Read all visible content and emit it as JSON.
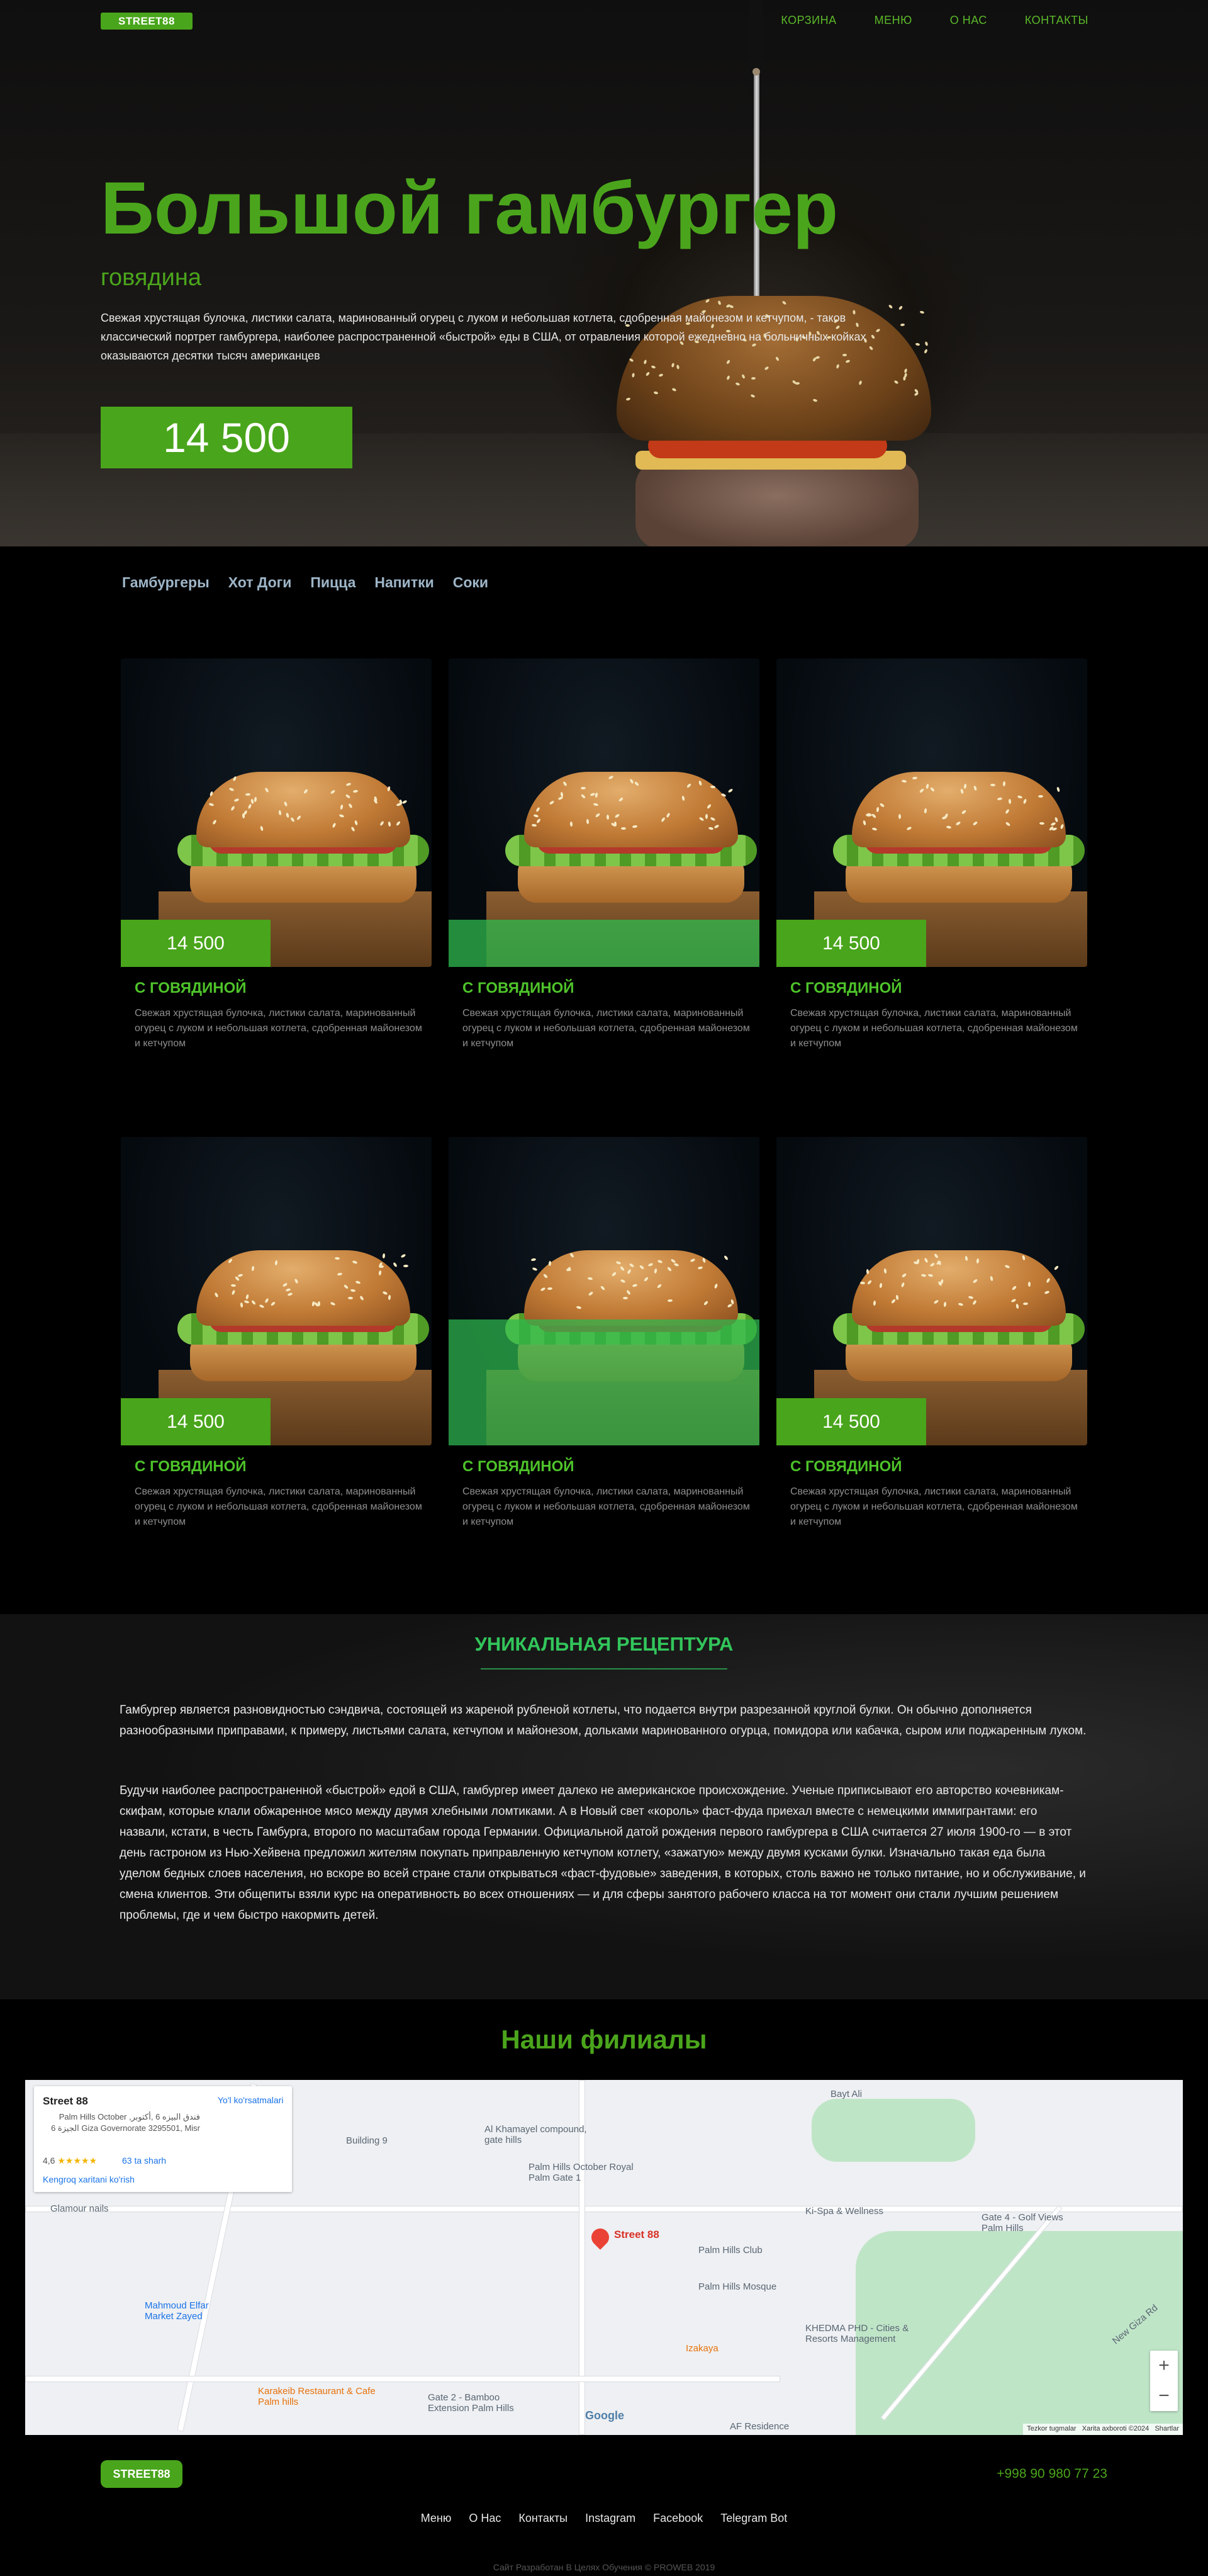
{
  "brand": {
    "logo": "STREET88",
    "accent": "#49a51b",
    "highlight": "#2eb94e"
  },
  "nav": {
    "items": [
      "КОРЗИНА",
      "МЕНЮ",
      "О НАС",
      "КОНТАКТЫ"
    ]
  },
  "hero": {
    "title": "Большой гамбургер",
    "subtitle": "говядина",
    "description": "Свежая хрустящая булочка, листики салата, маринованный огурец с луком и небольшая котлета, сдобренная майонезом и кетчупом, - таков классический портрет гамбургера, наиболее распространенной «быстрой» еды в США, от отравления которой ежедневно на больничных койках оказываются десятки тысяч американцев",
    "price": "14 500"
  },
  "categories": [
    "Гамбургеры",
    "Хот Доги",
    "Пицца",
    "Напитки",
    "Соки"
  ],
  "products": [
    {
      "price": "14 500",
      "title": "С ГОВЯДИНОЙ",
      "desc": "Свежая хрустящая булочка, листики салата, маринованный огурец с луком и небольшая котлета, сдобренная майонезом и кетчупом"
    },
    {
      "price": "",
      "title": "С ГОВЯДИНОЙ",
      "desc": "Свежая хрустящая булочка, листики салата, маринованный огурец с луком и небольшая котлета, сдобренная майонезом и кетчупом"
    },
    {
      "price": "14 500",
      "title": "С ГОВЯДИНОЙ",
      "desc": "Свежая хрустящая булочка, листики салата, маринованный огурец с луком и небольшая котлета, сдобренная майонезом и кетчупом"
    },
    {
      "price": "14 500",
      "title": "С ГОВЯДИНОЙ",
      "desc": "Свежая хрустящая булочка, листики салата, маринованный огурец с луком и небольшая котлета, сдобренная майонезом и кетчупом"
    },
    {
      "price": "",
      "title": "С ГОВЯДИНОЙ",
      "desc": "Свежая хрустящая булочка, листики салата, маринованный огурец с луком и небольшая котлета, сдобренная майонезом и кетчупом"
    },
    {
      "price": "14 500",
      "title": "С ГОВЯДИНОЙ",
      "desc": "Свежая хрустящая булочка, листики салата, маринованный огурец с луком и небольшая котлета, сдобренная майонезом и кетчупом"
    }
  ],
  "recipe": {
    "title": "УНИКАЛЬНАЯ РЕЦЕПТУРА",
    "p1": "Гамбургер является разновидностью сэндвича, состоящей из жареной рубленой котлеты, что подается внутри разрезанной круглой булки. Он обычно дополняется разнообразными приправами, к примеру, листьями салата, кетчупом и майонезом, дольками маринованного огурца, помидора или кабачка, сыром или поджаренным луком.",
    "p2": "Будучи наиболее распространенной «быстрой» едой в США, гамбургер имеет далеко не американское происхождение. Ученые приписывают его авторство кочевникам-скифам, которые клали обжаренное мясо между двумя хлебными ломтиками. А в Новый свет «король» фаст-фуда приехал вместе с немецкими иммигрантами: его назвали, кстати, в честь Гамбурга, второго по масштабам города Германии. Официальной датой рождения первого гамбургера в США считается 27 июля 1900-го — в этот день гастроном из Нью-Хейвена предложил жителям покупать приправленную кетчупом котлету, «зажатую» между двумя кусками булки. Изначально такая еда была уделом бедных слоев населения, но вскоре во всей стране стали открываться «фаст-фудовые» заведения, в которых, столь важно не только питание, но и обслуживание, и смена клиентов. Эти общепиты взяли курс на оперативность во всех отношениях — и для сферы занятого рабочего класса на тот момент они стали лучшим решением проблемы, где и чем быстро накормить детей."
  },
  "branches": {
    "title": "Наши филиалы",
    "map": {
      "place_name": "Street 88",
      "address": "Palm Hills October ,فندق البيزه 6 ,أكتوبر الجيزة 6 Giza Governorate 3295501, Misr",
      "directions": "Yo'l ko'rsatmalari",
      "rating": "4,6",
      "stars": "★★★★★",
      "reviews": "63 ta sharh",
      "bigger_map": "Kengroq xaritani ko'rish",
      "pin_label": "Street 88",
      "labels": [
        "Bayt Ali",
        "Al Khamayel compound, gate hills",
        "Palm Hills October Royal Palm Gate 1",
        "Building 9",
        "Glamour nails",
        "Palm Hills Club",
        "Palm Hills Mosque",
        "Ki-Spa & Wellness",
        "Gate 4 - Golf Views Palm Hills",
        "Mahmoud Elfar Market Zayed",
        "Izakaya",
        "KHEDMA PHD - Cities & Resorts Management",
        "Karakeib Restaurant & Cafe Palm hills",
        "Gate 2 - Bamboo Extension Palm Hills",
        "New Giza Rd",
        "AF Residence"
      ],
      "attribution": [
        "Tezkor tugmalar",
        "Xarita axboroti ©2024",
        "Shartlar"
      ],
      "google": "Google",
      "zoom_in": "+",
      "zoom_out": "−"
    }
  },
  "footer": {
    "logo": "STREET88",
    "phone": "+998 90 980 77 23",
    "links": [
      "Меню",
      "О Нас",
      "Контакты",
      "Instagram",
      "Facebook",
      "Telegram Bot"
    ],
    "copyright": "Сайт Разработан В Целях Обучения © PROWEB 2019"
  }
}
